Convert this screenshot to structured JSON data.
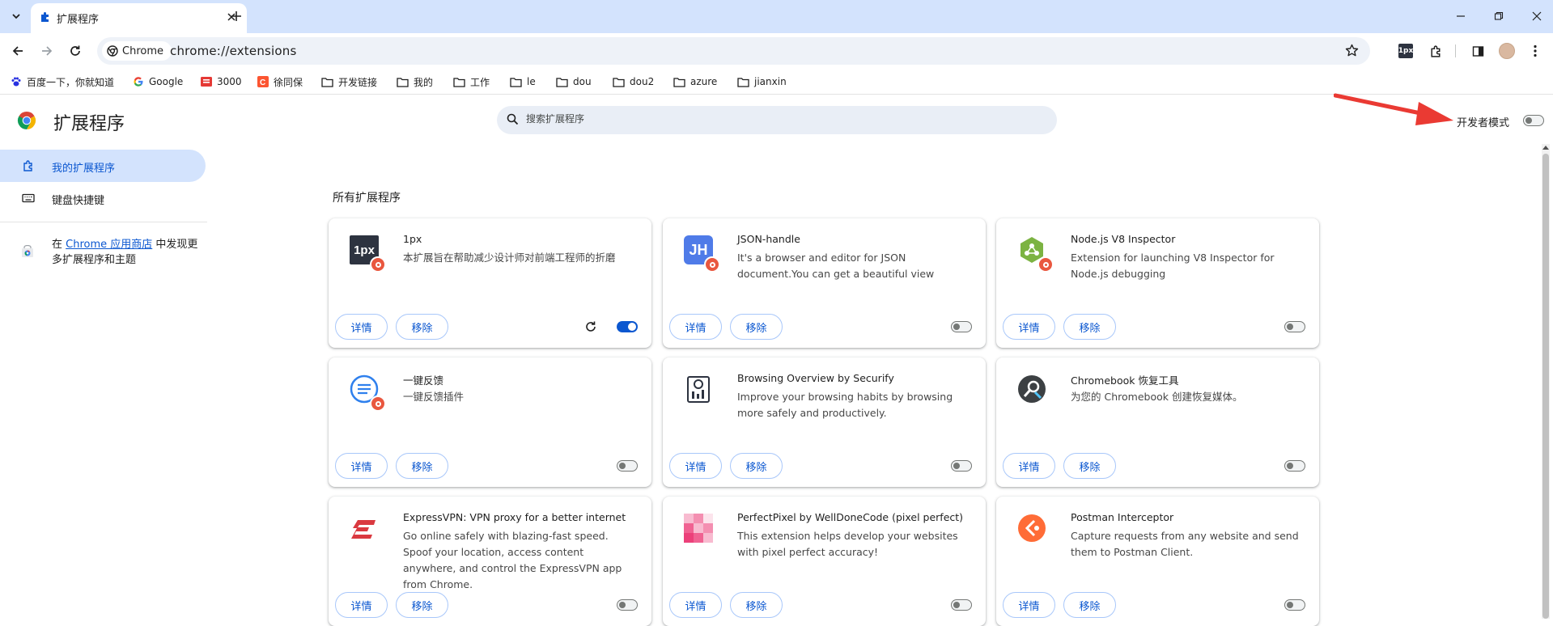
{
  "tab": {
    "title": "扩展程序"
  },
  "toolbar": {
    "site_chip": "Chrome",
    "url": "chrome://extensions",
    "ext_1px_label": "1px"
  },
  "bookmarks": [
    {
      "label": "百度一下，你就知道",
      "icon": "baidu-icon"
    },
    {
      "label": "Google",
      "icon": "google-icon"
    },
    {
      "label": "3000",
      "icon": "site-icon"
    },
    {
      "label": "徐同保",
      "icon": "csdn-icon"
    },
    {
      "label": "开发链接",
      "icon": "folder-icon"
    },
    {
      "label": "我的",
      "icon": "folder-icon"
    },
    {
      "label": "工作",
      "icon": "folder-icon"
    },
    {
      "label": "le",
      "icon": "folder-icon"
    },
    {
      "label": "dou",
      "icon": "folder-icon"
    },
    {
      "label": "dou2",
      "icon": "folder-icon"
    },
    {
      "label": "azure",
      "icon": "folder-icon"
    },
    {
      "label": "jianxin",
      "icon": "folder-icon"
    }
  ],
  "header": {
    "title": "扩展程序",
    "search_placeholder": "搜索扩展程序",
    "dev_mode_label": "开发者模式",
    "dev_mode_on": false
  },
  "sidebar": {
    "items": [
      {
        "label": "我的扩展程序",
        "icon": "puzzle-icon",
        "active": true
      },
      {
        "label": "键盘快捷键",
        "icon": "keyboard-icon",
        "active": false
      }
    ],
    "store_prefix": "在 ",
    "store_link": "Chrome 应用商店",
    "store_suffix": " 中发现更多扩展程序和主题"
  },
  "main": {
    "section_title": "所有扩展程序",
    "details_label": "详情",
    "remove_label": "移除",
    "extensions": [
      {
        "name": "1px",
        "description": "本扩展旨在帮助减少设计师对前端工程师的折磨",
        "icon": "1px",
        "enabled": true,
        "reload": true
      },
      {
        "name": "JSON-handle",
        "description": "It's a browser and editor for JSON document.You can get a beautiful view",
        "icon": "JH",
        "enabled": false
      },
      {
        "name": "Node.js V8 Inspector",
        "description": "Extension for launching V8 Inspector for Node.js debugging",
        "icon": "nodejs-icon",
        "enabled": false
      },
      {
        "name": "一键反馈",
        "description": "一键反馈插件",
        "icon": "feedback-icon",
        "enabled": false
      },
      {
        "name": "Browsing Overview by Securify",
        "description": "Improve your browsing habits by browsing more safely and productively.",
        "icon": "securify-icon",
        "enabled": false
      },
      {
        "name": "Chromebook 恢复工具",
        "description": "为您的 Chromebook 创建恢复媒体。",
        "icon": "chromebook-recovery-icon",
        "enabled": false
      },
      {
        "name": "ExpressVPN: VPN proxy for a better internet",
        "description": "Go online safely with blazing-fast speed. Spoof your location, access content anywhere, and control the ExpressVPN app from Chrome.",
        "icon": "expressvpn-icon",
        "enabled": false
      },
      {
        "name": "PerfectPixel by WellDoneCode (pixel perfect)",
        "description": "This extension helps develop your websites with pixel perfect accuracy!",
        "icon": "perfectpixel-icon",
        "enabled": false
      },
      {
        "name": "Postman Interceptor",
        "description": "Capture requests from any website and send them to Postman Client.",
        "icon": "postman-icon",
        "enabled": false
      }
    ]
  }
}
